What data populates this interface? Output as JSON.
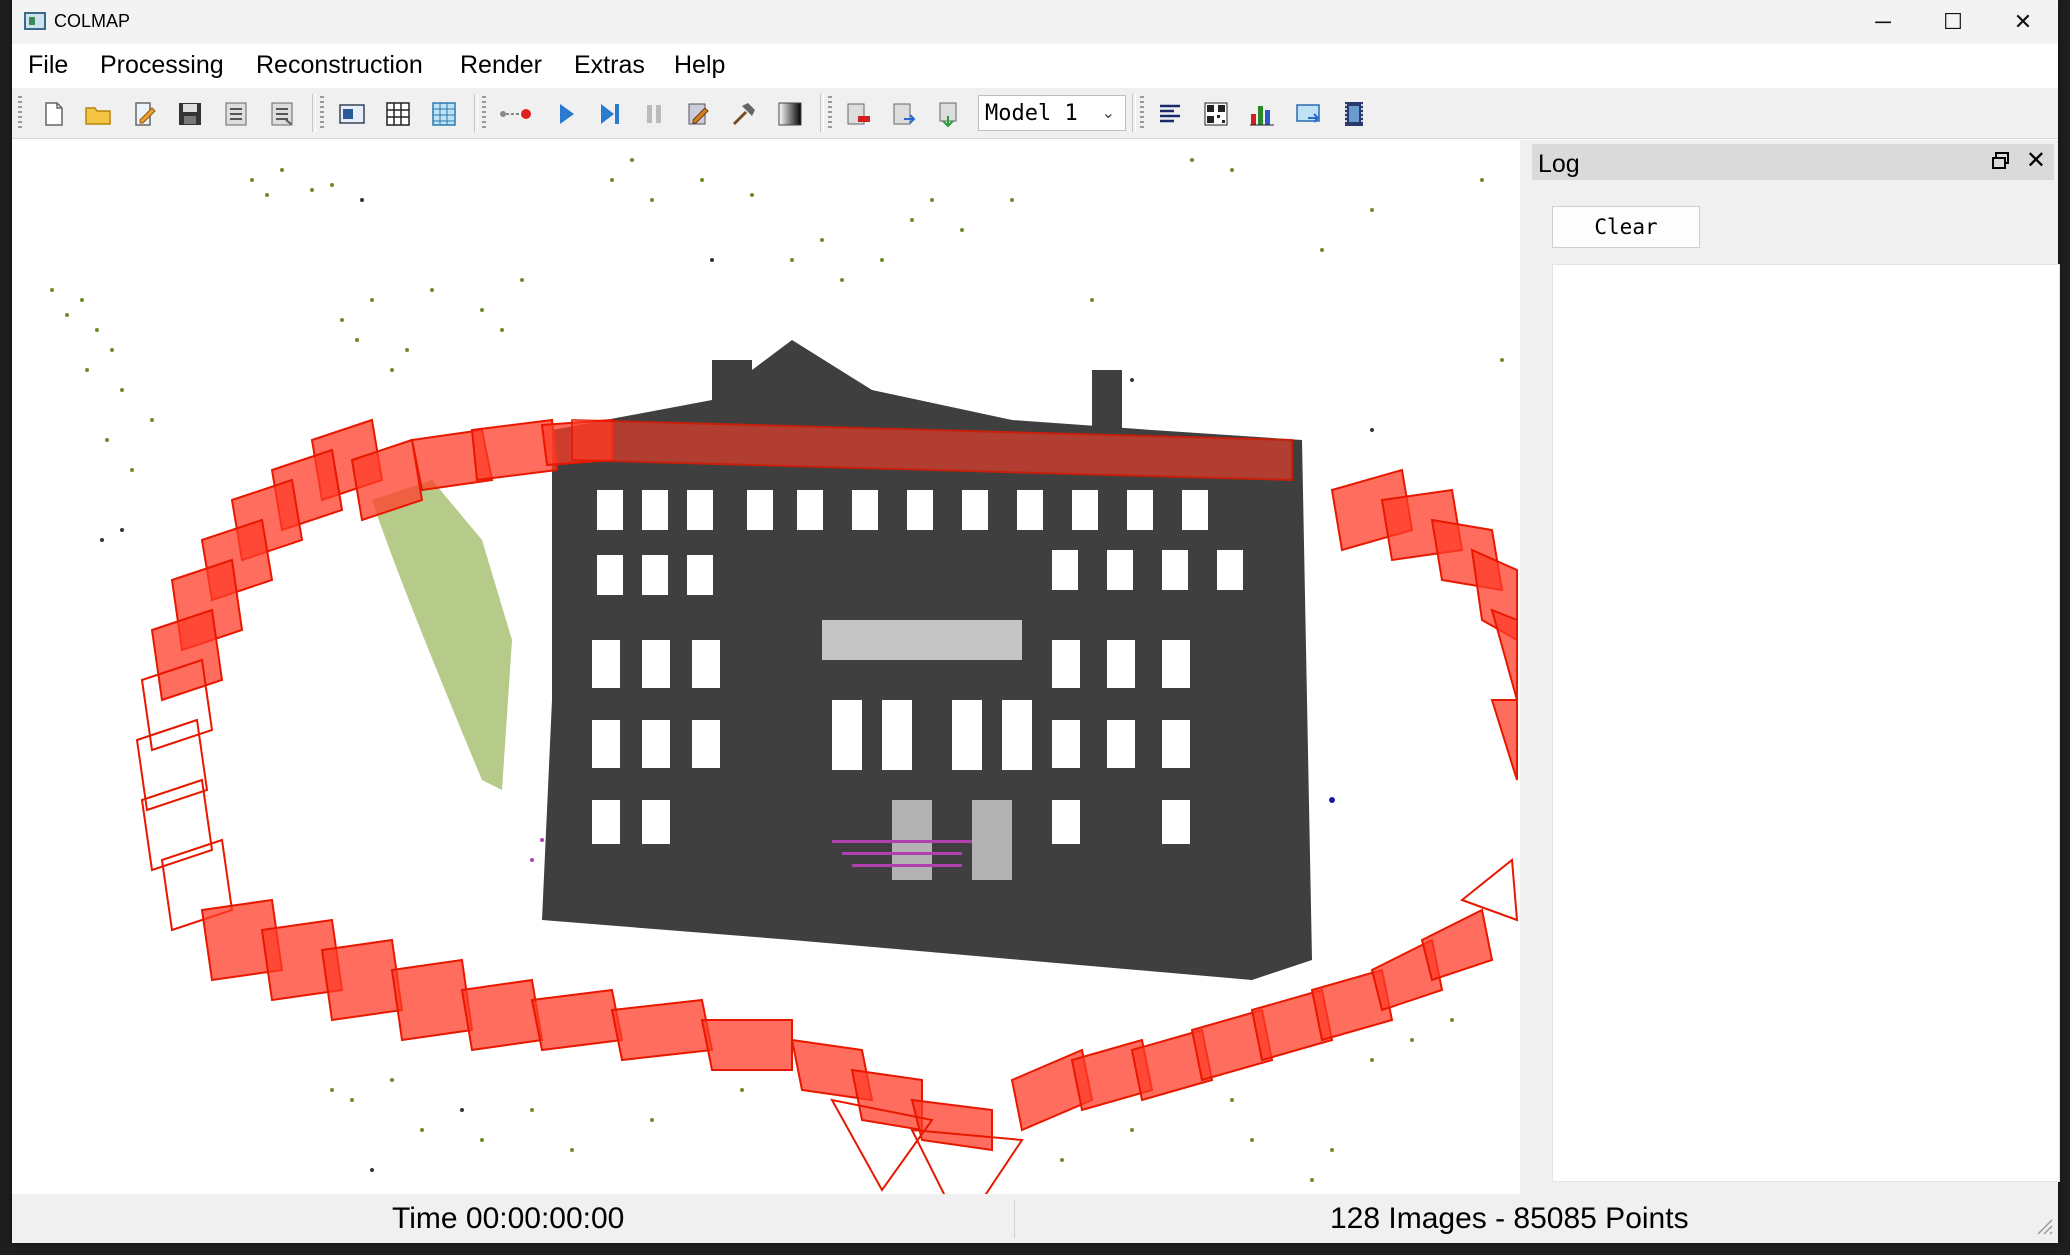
{
  "window": {
    "title": "COLMAP",
    "controls": {
      "minimize": "─",
      "maximize": "☐",
      "close": "✕"
    }
  },
  "menu": [
    "File",
    "Processing",
    "Reconstruction",
    "Render",
    "Extras",
    "Help"
  ],
  "toolbar": {
    "groups": [
      [
        "new-project-icon",
        "open-project-icon",
        "edit-project-icon",
        "save-project-icon",
        "import-model-icon",
        "export-model-icon"
      ],
      [
        "feature-extraction-icon",
        "feature-matching-icon",
        "database-management-icon"
      ],
      [
        "start-reconstruction-icon",
        "step-reconstruction-icon",
        "pause-reconstruction-icon",
        "bundle-adjustment-icon",
        "dense-reconstruction-icon",
        "render-options-icon"
      ],
      [
        "reconstruction-stats-icon",
        "match-matrix-icon",
        "log-icon",
        "show-log-icon",
        "grab-movie-icon"
      ]
    ],
    "model_select": {
      "value": "Model 1"
    }
  },
  "log": {
    "title": "Log",
    "clear_label": "Clear",
    "float_icon": "float-icon",
    "close_icon": "close-icon"
  },
  "status": {
    "time": "Time 00:00:00:00",
    "counts": "128 Images - 85085 Points"
  },
  "colors": {
    "camera": "#ff1a00",
    "building": "#3f3f3f",
    "vegetation": "#6b8e23",
    "accent_points": "#b040b0"
  }
}
